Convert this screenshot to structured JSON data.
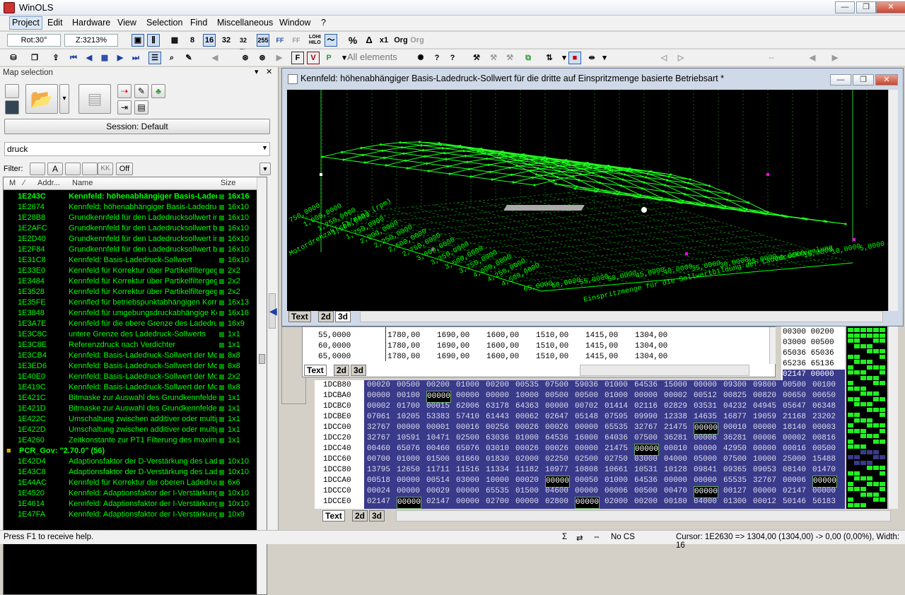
{
  "app": {
    "title": "WinOLS"
  },
  "window_buttons": {
    "minimize": "—",
    "restore": "❐",
    "close": "✕"
  },
  "menu": [
    "Project",
    "Edit",
    "Hardware",
    "View",
    "Selection",
    "Find",
    "Miscellaneous",
    "Window",
    "?"
  ],
  "toolbar1": {
    "rot": "Rot:30°",
    "zoom": "Z:3213%",
    "btn_8": "8",
    "btn_16": "16",
    "btn_32": "32",
    "btn_32fl": "32 Fl.",
    "btn_255": "255",
    "btn_ff": "FF",
    "btn_ff2": "FF",
    "btn_lohi": "LOHI HILO",
    "btn_pct": "%",
    "btn_delta": "Δ",
    "btn_x1": "x1",
    "btn_org": "Org",
    "btn_org2": "Org"
  },
  "toolbar2": {
    "all_elements": "All elements"
  },
  "left_pane": {
    "header": "Map selection",
    "session": "Session: Default",
    "search_value": "druck",
    "filter_label": "Filter:",
    "filter_off": "Off",
    "columns": {
      "m": "M",
      "sort": "⁄",
      "addr": "Addr...",
      "name": "Name",
      "size": "Size"
    }
  },
  "rows": [
    {
      "addr": "1E243C",
      "name": "Kennfeld: höhenabhängiger Basis-Ladedruck",
      "size": "16x16",
      "bold": true
    },
    {
      "addr": "1E2674",
      "name": "Kennfeld: höhenabhängiger Basis-Ladedruck",
      "size": "16x10"
    },
    {
      "addr": "1E28B8",
      "name": "Grundkennfeld für den Ladedrucksollwert in",
      "size": "16x10"
    },
    {
      "addr": "1E2AFC",
      "name": "Grundkennfeld für den Ladedrucksollwert be",
      "size": "16x10"
    },
    {
      "addr": "1E2D40",
      "name": "Grundkennfeld für den Ladedrucksollwert in",
      "size": "16x10"
    },
    {
      "addr": "1E2F84",
      "name": "Grundkennfeld für den Ladedrucksollwert be",
      "size": "16x10"
    },
    {
      "addr": "1E31C8",
      "name": "Kennfeld: Basis-Ladedruck-Sollwert",
      "size": "16x10"
    },
    {
      "addr": "1E33E0",
      "name": "Kennfeld für Korrektur über Partikelfiltergege",
      "size": "2x2"
    },
    {
      "addr": "1E3484",
      "name": "Kennfeld für Korrektur über Partikelfiltergege",
      "size": "2x2"
    },
    {
      "addr": "1E3528",
      "name": "Kennfeld für Korrektur über Partikelfiltergege",
      "size": "2x2"
    },
    {
      "addr": "1E35FE",
      "name": "Kennfled für betriebspunktabhängigen Korrel",
      "size": "16x13"
    },
    {
      "addr": "1E3848",
      "name": "Kennfeld für umgebungsdruckabhängige Kor",
      "size": "16x16"
    },
    {
      "addr": "1E3A7E",
      "name": "Kennfeld für die obere Grenze des Ladedruc",
      "size": "16x9"
    },
    {
      "addr": "1E3C8C",
      "name": "untere Grenze des Ladedruck-Sollwerts",
      "size": "1x1"
    },
    {
      "addr": "1E3C8E",
      "name": "Referenzdruck nach Verdichter",
      "size": "1x1"
    },
    {
      "addr": "1E3CB4",
      "name": "Kennfeld: Basis-Ladedruck-Sollwert der Moto",
      "size": "8x8"
    },
    {
      "addr": "1E3ED6",
      "name": "Kennfeld: Basis-Ladedruck-Sollwert der Moto",
      "size": "8x8"
    },
    {
      "addr": "1E40E0",
      "name": "Kennfeld: Basis-Ladedruck-Sollwert der Moto",
      "size": "2x2"
    },
    {
      "addr": "1E419C",
      "name": "Kennfeld: Basis-Ladedruck-Sollwert der Moto",
      "size": "8x8"
    },
    {
      "addr": "1E421C",
      "name": "Bitmaske zur Auswahl des Grundkennfeldes",
      "size": "1x1"
    },
    {
      "addr": "1E421D",
      "name": "Bitmaske zur Auswahl des Grundkennfeldes",
      "size": "1x1"
    },
    {
      "addr": "1E422C",
      "name": "Umschaltung zwischen additiver oder multipli",
      "size": "1x1"
    },
    {
      "addr": "1E422D",
      "name": "Umschaltung zwischen additiver oder multipli",
      "size": "1x1"
    },
    {
      "addr": "1E4260",
      "name": "Zeitkonstante zur PT1 Filterung des maximal",
      "size": "1x1"
    },
    {
      "folder": "PCR_Gov: \"2.70.0\" (56)"
    },
    {
      "addr": "1E42D4",
      "name": "Adaptionsfaktor der D-Verstärkung des Lade",
      "size": "10x10"
    },
    {
      "addr": "1E43C8",
      "name": "Adaptionsfaktor der D-Verstärkung des Lade",
      "size": "10x10"
    },
    {
      "addr": "1E44AC",
      "name": "Kennfeld für Korrektur der oberen Ladedruck",
      "size": "6x6"
    },
    {
      "addr": "1E4520",
      "name": "Kennfeld: Adaptionsfaktor der I-Verstärkung",
      "size": "10x10"
    },
    {
      "addr": "1E4614",
      "name": "Kennfeld: Adaptionsfaktor der I-Verstärkung",
      "size": "10x10"
    },
    {
      "addr": "1E47FA",
      "name": "Kennfeld: Adaptionsfaktor der I-Verstärkung",
      "size": "10x9"
    }
  ],
  "mapwin": {
    "title": "Kennfeld: höhenabhängiger Basis-Ladedruck-Sollwert für die dritte auf Einspritzmenge basierte Betriebsart *"
  },
  "plot": {
    "rpm_label": "Motordrehzahl [1/min] (rpm)",
    "inj_label": "Einspritzmenge für die Sollwertbildung der Ladedruckregelung",
    "rpm_ticks": [
      "750,0000",
      "1,000,0000",
      "1,250,0000",
      "1,500,0000",
      "1,750,0000",
      "2,000,0000",
      "2,250,0000",
      "2,500,0000",
      "2,750,0000",
      "3,000,0000",
      "3,250,0000",
      "3,500,0000",
      "3,750,0000",
      "4,000,0000",
      "4,250,0000",
      "4,500,0000"
    ],
    "inj_ticks": [
      "65,0000",
      "60,0000",
      "55,0000",
      "50,0000",
      "45,0000",
      "40,0000",
      "35,0000",
      "30,0000",
      "25,0000",
      "20,0000",
      "15,0000",
      "10,0000",
      "5,0000",
      "0,0000"
    ]
  },
  "tabs": {
    "text": "Text",
    "t2d": "2d",
    "t3d": "3d"
  },
  "table_rows": [
    {
      "x": "55,0000",
      "v": [
        "1780,00",
        "1690,00",
        "1600,00",
        "1510,00",
        "1415,00",
        "1304,00"
      ]
    },
    {
      "x": "60,0000",
      "v": [
        "1780,00",
        "1690,00",
        "1600,00",
        "1510,00",
        "1415,00",
        "1304,00"
      ]
    },
    {
      "x": "65,0000",
      "v": [
        "1780,00",
        "1690,00",
        "1600,00",
        "1510,00",
        "1415,00",
        "1304,00"
      ]
    }
  ],
  "right_hex_top": [
    "00300 00200",
    "03000 00500",
    "65036 65036",
    "65236 65136",
    "02147 00000"
  ],
  "hex_rows": [
    {
      "addr": "1DCB80",
      "v": [
        "00020",
        "00500",
        "00200",
        "01000",
        "00200",
        "00535",
        "07500",
        "59036",
        "01000",
        "64536",
        "15000",
        "00000",
        "09300",
        "09800",
        "00500",
        "00100"
      ]
    },
    {
      "addr": "1DCBA0",
      "v": [
        "00000",
        "00100",
        "00000",
        "00000",
        "00000",
        "10000",
        "00500",
        "00500",
        "01000",
        "00000",
        "00002",
        "00512",
        "00825",
        "00820",
        "00650",
        "00650"
      ]
    },
    {
      "addr": "1DCBC0",
      "v": [
        "00002",
        "01700",
        "00015",
        "62006",
        "63178",
        "64363",
        "00000",
        "00702",
        "01414",
        "02116",
        "02829",
        "03531",
        "04232",
        "04945",
        "05647",
        "06348"
      ]
    },
    {
      "addr": "1DCBE0",
      "v": [
        "07061",
        "10205",
        "53383",
        "57410",
        "61443",
        "00062",
        "02647",
        "05148",
        "07595",
        "09990",
        "12338",
        "14635",
        "16877",
        "19059",
        "21168",
        "23202"
      ]
    },
    {
      "addr": "1DCC00",
      "v": [
        "32767",
        "00000",
        "00001",
        "00016",
        "00256",
        "00026",
        "00026",
        "00000",
        "65535",
        "32767",
        "21475",
        "00000",
        "00010",
        "00000",
        "18140",
        "00003"
      ]
    },
    {
      "addr": "1DCC20",
      "v": [
        "32767",
        "10591",
        "10471",
        "02500",
        "63036",
        "01000",
        "64536",
        "16000",
        "64036",
        "07500",
        "36281",
        "00006",
        "36281",
        "00006",
        "00002",
        "00816"
      ]
    },
    {
      "addr": "1DCC40",
      "v": [
        "00460",
        "65076",
        "00460",
        "65076",
        "03010",
        "00026",
        "00026",
        "00000",
        "21475",
        "00000",
        "00010",
        "00000",
        "42950",
        "00000",
        "00016",
        "00500"
      ]
    },
    {
      "addr": "1DCC60",
      "v": [
        "00700",
        "01000",
        "01500",
        "01660",
        "01830",
        "02000",
        "02250",
        "02500",
        "02750",
        "03000",
        "04000",
        "05000",
        "07500",
        "10000",
        "25000",
        "15488"
      ]
    },
    {
      "addr": "1DCC80",
      "v": [
        "13795",
        "12650",
        "11711",
        "11516",
        "11334",
        "11182",
        "10977",
        "10808",
        "10661",
        "10531",
        "10128",
        "09841",
        "09365",
        "09053",
        "08140",
        "01470"
      ]
    },
    {
      "addr": "1DCCA0",
      "v": [
        "00518",
        "00000",
        "00514",
        "03000",
        "10000",
        "00020",
        "00000",
        "00050",
        "01000",
        "64536",
        "00000",
        "00000",
        "65535",
        "32767",
        "00006",
        "00000"
      ]
    },
    {
      "addr": "1DCCC0",
      "v": [
        "00024",
        "00000",
        "00029",
        "00000",
        "65535",
        "01500",
        "04600",
        "00000",
        "00006",
        "00500",
        "00470",
        "00000",
        "00127",
        "00000",
        "02147",
        "00000"
      ]
    },
    {
      "addr": "1DCCE0",
      "v": [
        "02147",
        "00000",
        "02147",
        "00000",
        "02700",
        "00000",
        "02800",
        "00000",
        "02000",
        "00200",
        "00180",
        "04000",
        "01300",
        "00012",
        "50146",
        "56183"
      ]
    }
  ],
  "status": {
    "help": "Press F1 to receive help.",
    "cs": "No CS",
    "cursor": "Cursor: 1E2630 => 1304,00 (1304,00) ->  0,00 (0,00%), Width: 16"
  }
}
